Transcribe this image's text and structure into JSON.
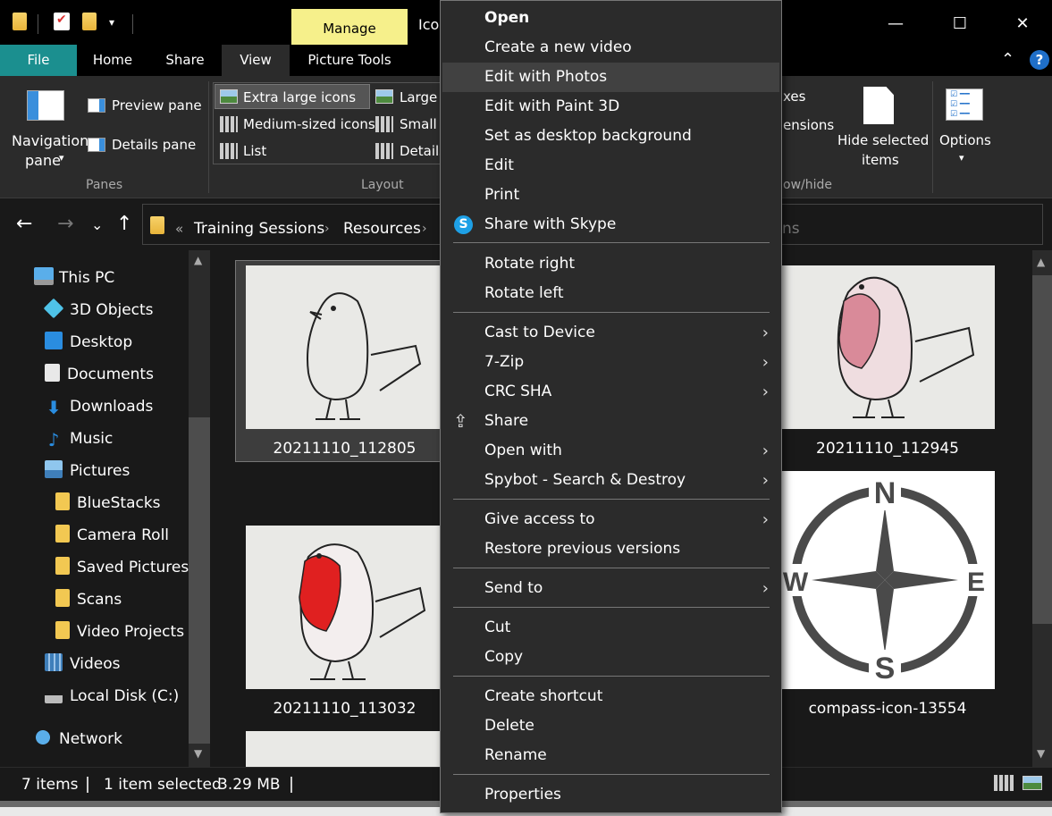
{
  "window": {
    "title": "Ico",
    "manage_tab": "Manage",
    "minimize": "—",
    "maximize": "☐",
    "close": "✕"
  },
  "ribbon_tabs": {
    "file": "File",
    "home": "Home",
    "share": "Share",
    "view": "View",
    "picture_tools": "Picture Tools"
  },
  "ribbon": {
    "navigation_pane_line1": "Navigation",
    "navigation_pane_line2": "pane",
    "preview_pane": "Preview pane",
    "details_pane": "Details pane",
    "panes_group": "Panes",
    "layout": {
      "extra_large_icons": "Extra large icons",
      "large": "Large",
      "medium_sized_icons": "Medium-sized icons",
      "small": "Small",
      "list": "List",
      "details": "Details",
      "group_label": "Layout"
    },
    "show_hide": {
      "boxes_partial": "xes",
      "extensions_partial": "ensions",
      "hide_selected_line1": "Hide selected",
      "hide_selected_line2": "items",
      "group_label_partial": "ow/hide"
    },
    "options": "Options"
  },
  "address_bar": {
    "overflow": "«",
    "crumbs": [
      "Training Sessions",
      "Resources"
    ],
    "search_partial": "ns"
  },
  "nav_pane": {
    "items": [
      {
        "label": "This PC"
      },
      {
        "label": "3D Objects"
      },
      {
        "label": "Desktop"
      },
      {
        "label": "Documents"
      },
      {
        "label": "Downloads"
      },
      {
        "label": "Music"
      },
      {
        "label": "Pictures"
      },
      {
        "label": "BlueStacks"
      },
      {
        "label": "Camera Roll"
      },
      {
        "label": "Saved Pictures"
      },
      {
        "label": "Scans"
      },
      {
        "label": "Video Projects"
      },
      {
        "label": "Videos"
      },
      {
        "label": "Local Disk (C:)"
      },
      {
        "label": "Network"
      }
    ]
  },
  "files": [
    {
      "name": "20211110_112805"
    },
    {
      "name": "20211110_112945"
    },
    {
      "name": "20211110_113032"
    },
    {
      "name": "compass-icon-13554"
    }
  ],
  "compass_letters": {
    "n": "N",
    "e": "E",
    "s": "S",
    "w": "W"
  },
  "status_bar": {
    "items_count": "7 items",
    "selection": "1 item selected",
    "size": "3.29 MB"
  },
  "context_menu": {
    "items": [
      {
        "label": "Open"
      },
      {
        "label": "Create a new video"
      },
      {
        "label": "Edit with Photos"
      },
      {
        "label": "Edit with Paint 3D"
      },
      {
        "label": "Set as desktop background"
      },
      {
        "label": "Edit"
      },
      {
        "label": "Print"
      },
      {
        "label": "Share with Skype"
      },
      {
        "label": "Rotate right"
      },
      {
        "label": "Rotate left"
      },
      {
        "label": "Cast to Device"
      },
      {
        "label": "7-Zip"
      },
      {
        "label": "CRC SHA"
      },
      {
        "label": "Share"
      },
      {
        "label": "Open with"
      },
      {
        "label": "Spybot - Search & Destroy"
      },
      {
        "label": "Give access to"
      },
      {
        "label": "Restore previous versions"
      },
      {
        "label": "Send to"
      },
      {
        "label": "Cut"
      },
      {
        "label": "Copy"
      },
      {
        "label": "Create shortcut"
      },
      {
        "label": "Delete"
      },
      {
        "label": "Rename"
      },
      {
        "label": "Properties"
      }
    ]
  },
  "colors": {
    "file_tab": "#1b8f8f",
    "manage_tab": "#f6f08b",
    "robin_red": "#e02020",
    "skype_blue": "#1ea0e6"
  }
}
